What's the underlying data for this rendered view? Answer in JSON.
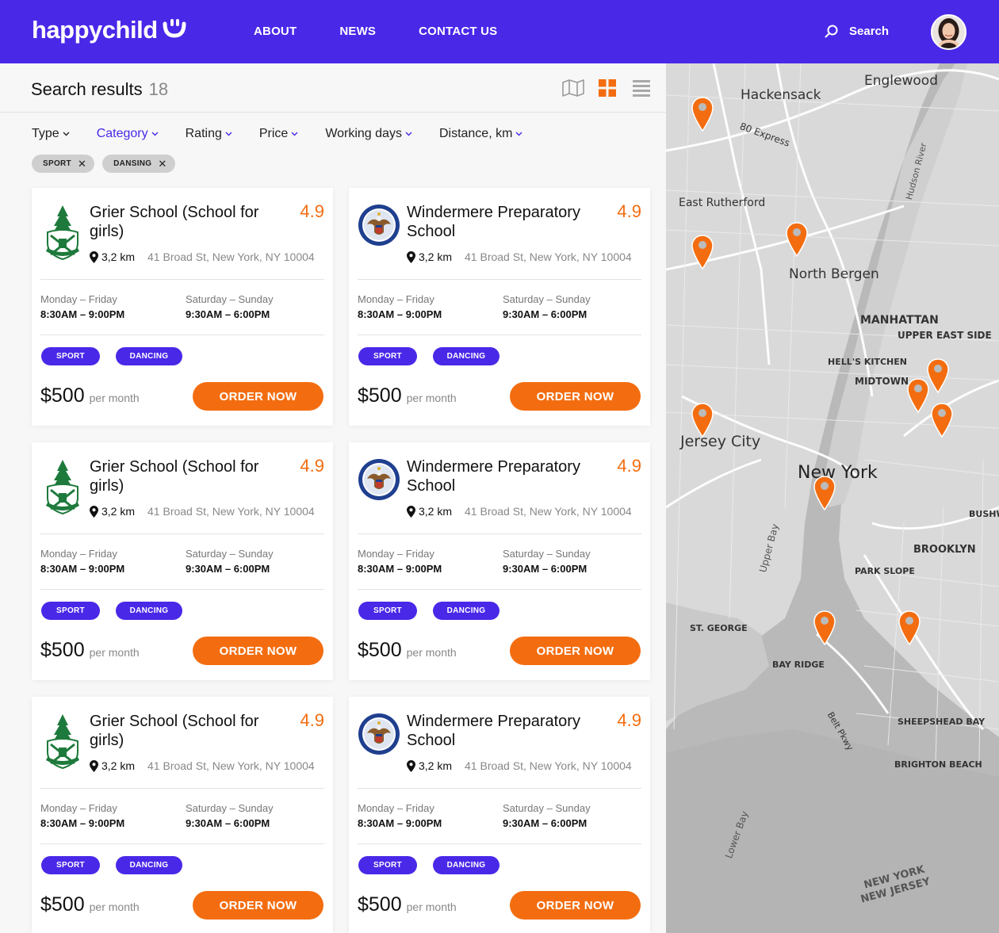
{
  "header": {
    "logo_text": "happychild",
    "nav": [
      "ABOUT",
      "NEWS",
      "CONTACT US"
    ],
    "search_label": "Search",
    "brand_color": "#4a28e8"
  },
  "results": {
    "title": "Search results",
    "count": "18"
  },
  "filters": [
    "Type",
    "Category",
    "Rating",
    "Price",
    "Working days",
    "Distance, km"
  ],
  "active_filter": "Category",
  "chips": [
    "SPORT",
    "DANSING"
  ],
  "cards": [
    {
      "name": "Grier School (School for girls)",
      "rating": "4.9",
      "distance": "3,2 km",
      "address": "41 Broad St, New York, NY 10004",
      "weekday_label": "Monday – Friday",
      "weekday_hours": "8:30AM – 9:00PM",
      "weekend_label": "Saturday – Sunday",
      "weekend_hours": "9:30AM – 6:00PM",
      "tags": [
        "SPORT",
        "DANCING"
      ],
      "price": "$500",
      "per": "per month",
      "cta": "ORDER NOW",
      "logo": "tree-crest"
    },
    {
      "name": "Windermere Preparatory School",
      "rating": "4.9",
      "distance": "3,2 km",
      "address": "41 Broad St, New York, NY 10004",
      "weekday_label": "Monday – Friday",
      "weekday_hours": "8:30AM – 9:00PM",
      "weekend_label": "Saturday – Sunday",
      "weekend_hours": "9:30AM – 6:00PM",
      "tags": [
        "SPORT",
        "DANCING"
      ],
      "price": "$500",
      "per": "per month",
      "cta": "ORDER NOW",
      "logo": "eagle-seal"
    },
    {
      "name": "Grier School (School for girls)",
      "rating": "4.9",
      "distance": "3,2 km",
      "address": "41 Broad St, New York, NY 10004",
      "weekday_label": "Monday – Friday",
      "weekday_hours": "8:30AM – 9:00PM",
      "weekend_label": "Saturday – Sunday",
      "weekend_hours": "9:30AM – 6:00PM",
      "tags": [
        "SPORT",
        "DANCING"
      ],
      "price": "$500",
      "per": "per month",
      "cta": "ORDER NOW",
      "logo": "tree-crest"
    },
    {
      "name": "Windermere Preparatory School",
      "rating": "4.9",
      "distance": "3,2 km",
      "address": "41 Broad St, New York, NY 10004",
      "weekday_label": "Monday – Friday",
      "weekday_hours": "8:30AM – 9:00PM",
      "weekend_label": "Saturday – Sunday",
      "weekend_hours": "9:30AM – 6:00PM",
      "tags": [
        "SPORT",
        "DANCING"
      ],
      "price": "$500",
      "per": "per month",
      "cta": "ORDER NOW",
      "logo": "eagle-seal"
    },
    {
      "name": "Grier School (School for girls)",
      "rating": "4.9",
      "distance": "3,2 km",
      "address": "41 Broad St, New York, NY 10004",
      "weekday_label": "Monday – Friday",
      "weekday_hours": "8:30AM – 9:00PM",
      "weekend_label": "Saturday – Sunday",
      "weekend_hours": "9:30AM – 6:00PM",
      "tags": [
        "SPORT",
        "DANCING"
      ],
      "price": "$500",
      "per": "per month",
      "cta": "ORDER NOW",
      "logo": "tree-crest"
    },
    {
      "name": "Windermere Preparatory School",
      "rating": "4.9",
      "distance": "3,2 km",
      "address": "41 Broad St, New York, NY 10004",
      "weekday_label": "Monday – Friday",
      "weekday_hours": "8:30AM – 9:00PM",
      "weekend_label": "Saturday – Sunday",
      "weekend_hours": "9:30AM – 6:00PM",
      "tags": [
        "SPORT",
        "DANCING"
      ],
      "price": "$500",
      "per": "per month",
      "cta": "ORDER NOW",
      "logo": "eagle-seal"
    }
  ],
  "map": {
    "labels": [
      "Englewood",
      "Hackensack",
      "East Rutherford",
      "North Bergen",
      "MANHATTAN",
      "UPPER EAST SIDE",
      "HELL'S KITCHEN",
      "MIDTOWN",
      "Jersey City",
      "New York",
      "BROOKLYN",
      "PARK SLOPE",
      "BUSHWICK",
      "ST. GEORGE",
      "BAY RIDGE",
      "SHEEPSHEAD BAY",
      "BRIGHTON BEACH",
      "Upper Bay",
      "Lower Bay",
      "NEW YORK",
      "NEW JERSEY",
      "80 Express",
      "Belt Pkwy",
      "Hudson River"
    ],
    "pin_color": "#f36d10",
    "pin_count": 11
  }
}
